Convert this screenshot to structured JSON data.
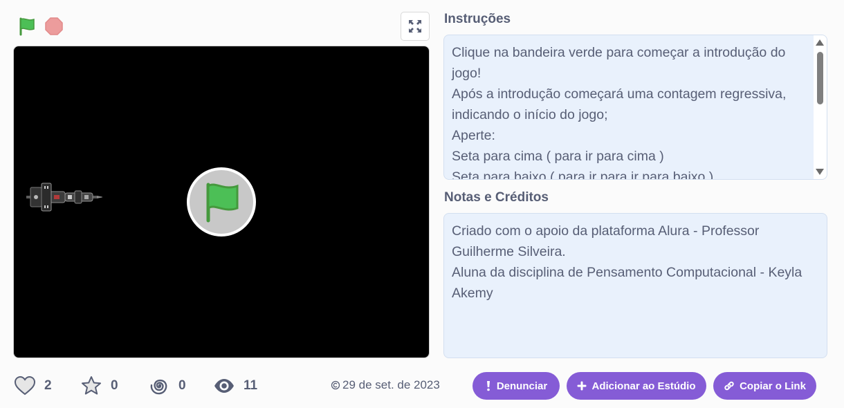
{
  "controls": {
    "green_flag_icon": "green-flag-icon",
    "stop_icon": "stop-sign-icon",
    "fullscreen_icon": "fullscreen-icon"
  },
  "instructions": {
    "title": "Instruções",
    "text": "Clique na bandeira verde para começar a introdução do jogo!\nApós a introdução começará uma contagem regressiva, indicando o início do jogo;\nAperte:\nSeta para cima ( para ir para cima )\nSeta para baixo ( para ir para ir para baixo )"
  },
  "notes": {
    "title": "Notas e Créditos",
    "text": "Criado com o apoio da plataforma Alura - Professor Guilherme Silveira.\nAluna da disciplina de Pensamento Computacional - Keyla Akemy"
  },
  "stats": {
    "loves": "2",
    "favorites": "0",
    "remixes": "0",
    "views": "11"
  },
  "date": "29 de set. de 2023",
  "actions": {
    "report": "Denunciar",
    "add_to_studio": "Adicionar ao Estúdio",
    "copy_link": "Copiar o Link"
  },
  "colors": {
    "accent": "#855cd6",
    "green_flag": "#4cbf56",
    "stop": "#ec9c9c",
    "text": "#575e75",
    "box_bg": "#e9f1fc"
  }
}
